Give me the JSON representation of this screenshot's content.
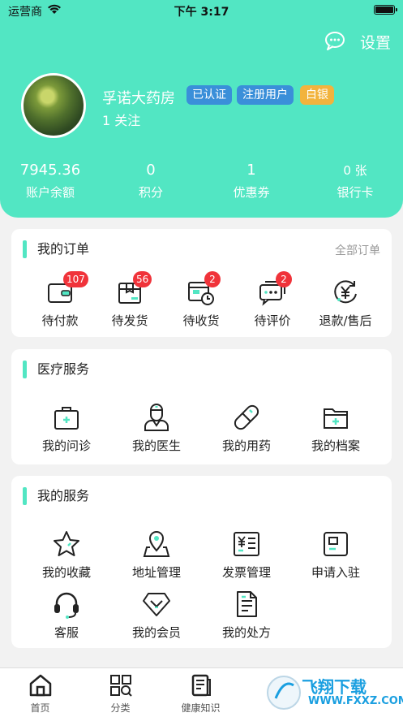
{
  "status_bar": {
    "carrier": "运营商",
    "time": "下午 3:17"
  },
  "header": {
    "settings_label": "设置",
    "user": {
      "name": "孚诺大药房",
      "follow": "1 关注"
    },
    "badges": [
      "已认证",
      "注册用户",
      "白银"
    ],
    "stats": [
      {
        "value": "7945.36",
        "label": "账户余额"
      },
      {
        "value": "0",
        "label": "积分"
      },
      {
        "value": "1",
        "label": "优惠券"
      },
      {
        "value": "0 张",
        "label": "银行卡"
      }
    ]
  },
  "orders": {
    "title": "我的订单",
    "link": "全部订单",
    "items": [
      {
        "label": "待付款",
        "badge": "107",
        "icon": "wallet-icon"
      },
      {
        "label": "待发货",
        "badge": "56",
        "icon": "box-icon"
      },
      {
        "label": "待收货",
        "badge": "2",
        "icon": "delivery-clock-icon"
      },
      {
        "label": "待评价",
        "badge": "2",
        "icon": "chat-icon"
      },
      {
        "label": "退款/售后",
        "badge": "",
        "icon": "refund-yen-icon"
      }
    ]
  },
  "medical": {
    "title": "医疗服务",
    "items": [
      {
        "label": "我的问诊",
        "icon": "medical-kit-icon"
      },
      {
        "label": "我的医生",
        "icon": "doctor-icon"
      },
      {
        "label": "我的用药",
        "icon": "pill-icon"
      },
      {
        "label": "我的档案",
        "icon": "folder-plus-icon"
      }
    ]
  },
  "services": {
    "title": "我的服务",
    "items": [
      {
        "label": "我的收藏",
        "icon": "star-icon"
      },
      {
        "label": "地址管理",
        "icon": "map-pin-icon"
      },
      {
        "label": "发票管理",
        "icon": "invoice-icon"
      },
      {
        "label": "申请入驻",
        "icon": "apply-icon"
      },
      {
        "label": "客服",
        "icon": "headset-icon"
      },
      {
        "label": "我的会员",
        "icon": "diamond-icon"
      },
      {
        "label": "我的处方",
        "icon": "prescription-icon"
      }
    ]
  },
  "tabbar": {
    "tabs": [
      {
        "label": "首页",
        "icon": "home-icon"
      },
      {
        "label": "分类",
        "icon": "category-icon"
      },
      {
        "label": "健康知识",
        "icon": "book-icon"
      }
    ]
  },
  "watermark": {
    "text": "飞翔下载",
    "url": "WWW.FXXZ.COM"
  },
  "colors": {
    "accent": "#52e6c3",
    "badge_blue": "#3a8fd9",
    "badge_gold": "#f2b33d",
    "notify_red": "#f0333a"
  }
}
